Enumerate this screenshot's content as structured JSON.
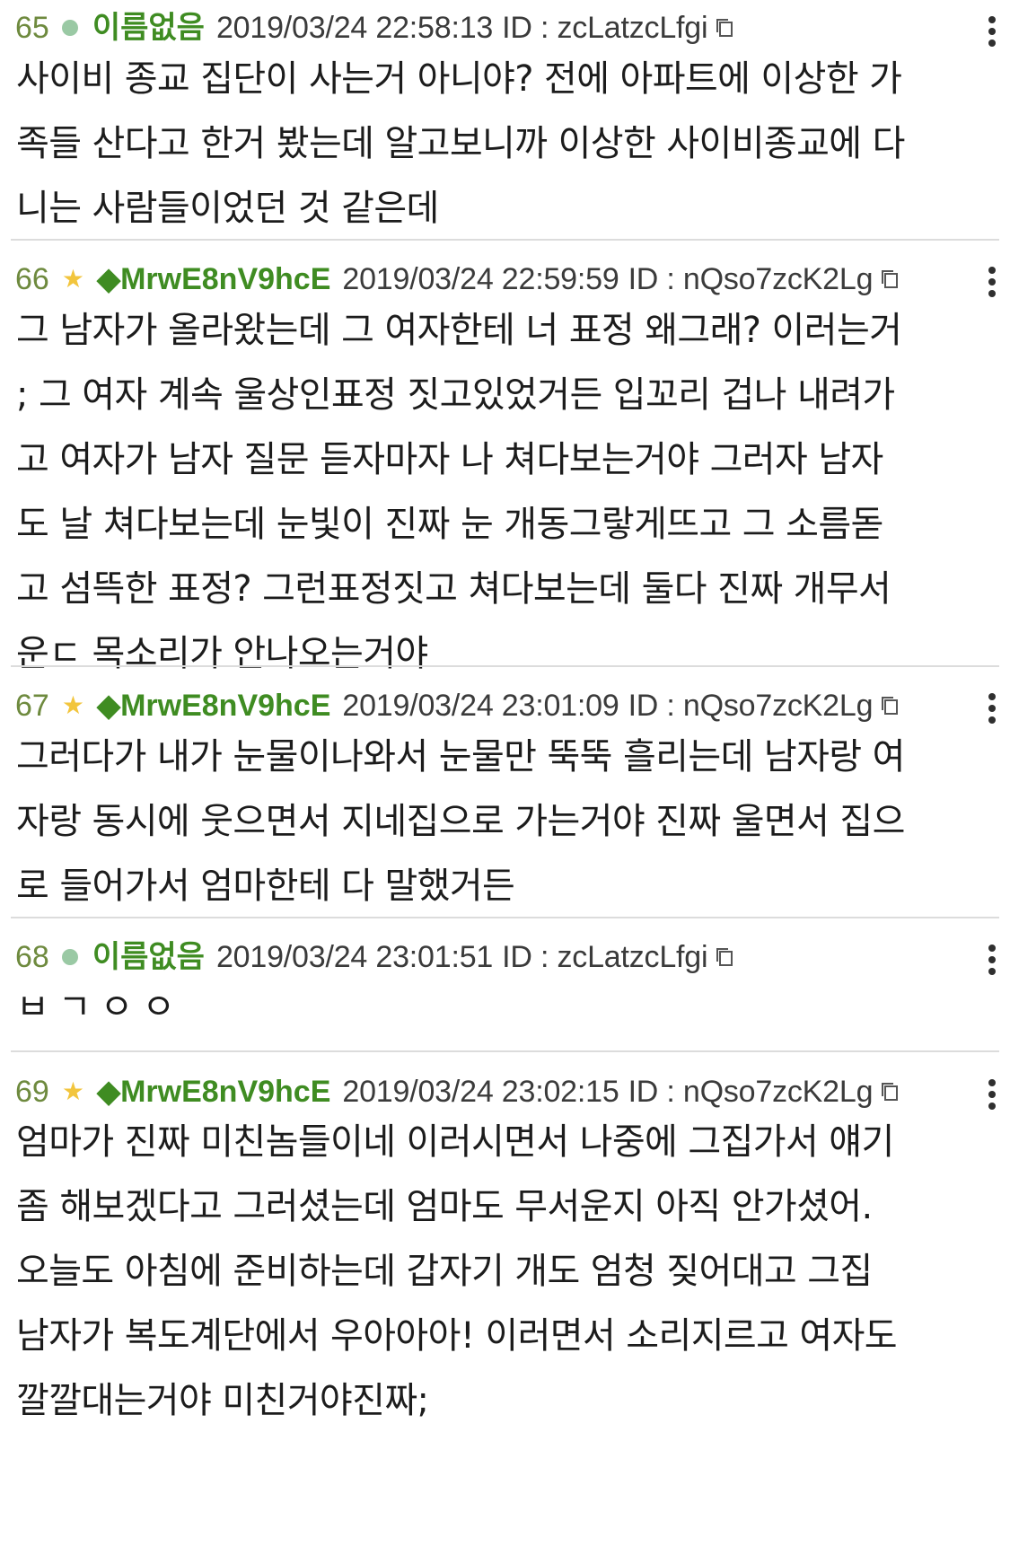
{
  "posts": [
    {
      "number": "65",
      "marker": "green-dot",
      "name": "이름없음",
      "datetime": "2019/03/24 22:58:13",
      "id_label": "ID : zcLatzcLfgi",
      "text": "사이비 종교 집단이 사는거 아니야? 전에 아파트에 이상한 가\n족들 산다고 한거 봤는데 알고보니까 이상한 사이비종교에 다\n니는 사람들이었던 것 같은데"
    },
    {
      "number": "66",
      "marker": "star",
      "name": "◆MrwE8nV9hcE",
      "datetime": "2019/03/24 22:59:59",
      "id_label": "ID : nQso7zcK2Lg",
      "text": "그 남자가 올라왔는데 그 여자한테 너 표정 왜그래? 이러는거\n; 그 여자 계속 울상인표정 짓고있었거든 입꼬리 겁나 내려가\n고 여자가 남자 질문 듣자마자 나 쳐다보는거야 그러자 남자\n도 날 쳐다보는데 눈빛이 진짜 눈 개동그랗게뜨고 그 소름돋\n고 섬뜩한 표정? 그런표정짓고 쳐다보는데 둘다 진짜 개무서\n운ㄷ 목소리가 안나오는거야"
    },
    {
      "number": "67",
      "marker": "star",
      "name": "◆MrwE8nV9hcE",
      "datetime": "2019/03/24 23:01:09",
      "id_label": "ID : nQso7zcK2Lg",
      "text": "그러다가 내가 눈물이나와서 눈물만 뚝뚝 흘리는데 남자랑 여\n자랑 동시에 웃으면서 지네집으로 가는거야 진짜 울면서 집으\n로 들어가서 엄마한테 다 말했거든"
    },
    {
      "number": "68",
      "marker": "green-dot",
      "name": "이름없음",
      "datetime": "2019/03/24 23:01:51",
      "id_label": "ID : zcLatzcLfgi",
      "text": "ㅂㄱㅇㅇ"
    },
    {
      "number": "69",
      "marker": "star",
      "name": "◆MrwE8nV9hcE",
      "datetime": "2019/03/24 23:02:15",
      "id_label": "ID : nQso7zcK2Lg",
      "text": "엄마가 진짜 미친놈들이네 이러시면서 나중에 그집가서 얘기\n좀 해보겠다고 그러셨는데 엄마도 무서운지 아직 안가셨어.\n오늘도 아침에 준비하는데 갑자기 개도 엄청 짖어대고 그집\n남자가 복도계단에서 우아아아! 이러면서 소리지르고 여자도\n깔깔대는거야 미친거야진짜;"
    }
  ],
  "colors": {
    "number": "#6e8a3e",
    "name": "#3f8c22",
    "dot": "#9ac9a4",
    "star": "#f2c53d",
    "divider": "#dcdcdc"
  },
  "icons": {
    "copy": "copy-icon",
    "more": "more-vertical-icon",
    "dot": "status-dot-icon",
    "star": "star-icon"
  }
}
